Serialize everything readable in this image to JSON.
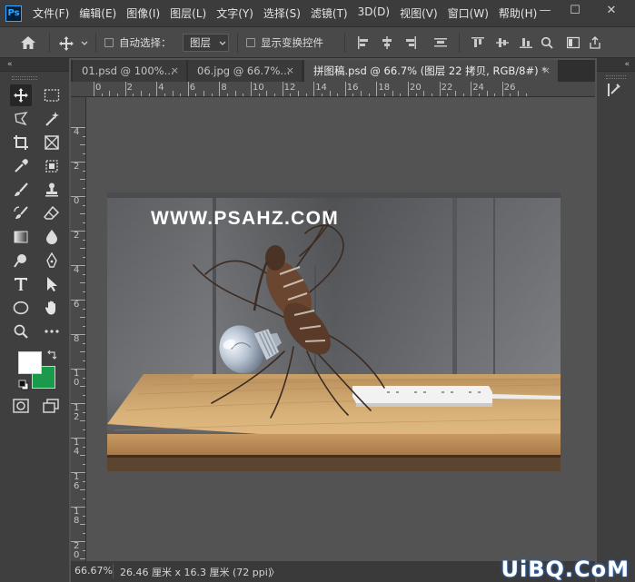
{
  "app": {
    "logo_text": "Ps"
  },
  "menu": [
    "文件(F)",
    "编辑(E)",
    "图像(I)",
    "图层(L)",
    "文字(Y)",
    "选择(S)",
    "滤镜(T)",
    "3D(D)",
    "视图(V)",
    "窗口(W)",
    "帮助(H)"
  ],
  "window_controls": {
    "minimize": "—",
    "maximize": "☐",
    "close": "✕"
  },
  "options": {
    "auto_select_label": "自动选择：",
    "layer_select_value": "图层",
    "show_transform_label": "显示变换控件"
  },
  "panels": {
    "collapse_left": "«",
    "collapse_right": "«"
  },
  "tabs": [
    {
      "title": "01.psd @ 100%...",
      "close": "×"
    },
    {
      "title": "06.jpg @ 66.7%...",
      "close": "×"
    },
    {
      "title": "拼图稿.psd @ 66.7% (图层 22 拷贝, RGB/8#) *",
      "close": "×"
    }
  ],
  "ruler_top_labels": [
    "0",
    "2",
    "4",
    "6",
    "8",
    "10",
    "12",
    "14",
    "16",
    "18",
    "20",
    "22",
    "24",
    "26"
  ],
  "ruler_left_labels": [
    "4",
    "2",
    "0",
    "2",
    "4",
    "6",
    "8",
    "1\n0",
    "1\n2",
    "1\n4",
    "1\n6",
    "1\n8",
    "2\n0"
  ],
  "canvas": {
    "watermark_text": "WWW.PSAHZ.COM"
  },
  "colors": {
    "foreground": "#ffffff",
    "background": "#1a9a4a",
    "accent": "#31a8ff"
  },
  "status": {
    "zoom": "66.67%",
    "doc_info": "26.46 厘米 x 16.3 厘米 (72 ppi)",
    "arrow": "〉"
  },
  "site_watermark": "UiBQ.CoM"
}
